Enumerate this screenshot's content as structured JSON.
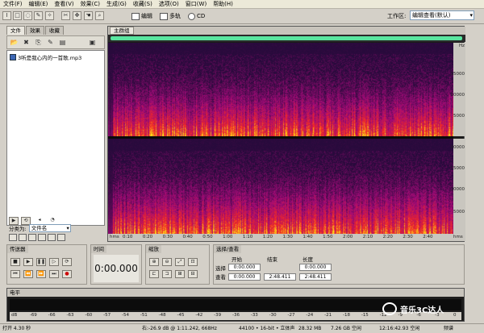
{
  "menu": [
    "文件(F)",
    "编辑(E)",
    "查看(V)",
    "效果(C)",
    "生成(G)",
    "收藏(S)",
    "选项(O)",
    "窗口(W)",
    "帮助(H)"
  ],
  "toolbar": {
    "mode_edit": "编辑",
    "mode_multitrack": "多轨",
    "mode_cd": "CD",
    "workspace_label": "工作区:",
    "workspace_value": "编辑查看(默认)"
  },
  "left_panel": {
    "tabs": [
      "文件",
      "效果",
      "收藏"
    ],
    "file": "3听是我心内的一首歌.mp3",
    "sort_label": "分类为:",
    "sort_value": "文件名"
  },
  "main_panel": {
    "tab": "主群组",
    "freq_unit": "Hz",
    "freq_ticks": [
      "15000",
      "10000",
      "5000",
      "20000",
      "15000",
      "10000",
      "5000"
    ],
    "time_ticks": [
      "hms",
      "0:10",
      "0:20",
      "0:30",
      "0:40",
      "0:50",
      "1:00",
      "1:10",
      "1:20",
      "1:30",
      "1:40",
      "1:50",
      "2:00",
      "2:10",
      "2:20",
      "2:30",
      "2:40",
      "hms"
    ]
  },
  "transport": {
    "title": "传送器"
  },
  "time": {
    "title": "时间",
    "value": "0:00.000"
  },
  "zoom": {
    "title": "缩放"
  },
  "selection": {
    "title": "选择/查看",
    "col_start": "开始",
    "col_end": "结束",
    "col_length": "长度",
    "row_select": "选择",
    "row_view": "查看",
    "sel_start": "0:00.000",
    "sel_length": "0:00.000",
    "view_start": "0:00.000",
    "view_end": "2:48.411",
    "view_length": "2:48.411"
  },
  "level": {
    "title": "电平",
    "scale": [
      "dB",
      "-69",
      "-66",
      "-63",
      "-60",
      "-57",
      "-54",
      "-51",
      "-48",
      "-45",
      "-42",
      "-39",
      "-36",
      "-33",
      "-30",
      "-27",
      "-24",
      "-21",
      "-18",
      "-15",
      "-12",
      "-9",
      "-6",
      "-3",
      "0"
    ]
  },
  "status": {
    "open_time": "打开 4.30 秒",
    "cursor": "右:-26.9 dB @ 1:11.242, 668Hz",
    "format": "44100 • 16-bit • 立体声",
    "size": "28.32 MB",
    "free": "7.26 GB 空闲",
    "free_time": "12:16:42.93 空闲",
    "view": "频谱"
  },
  "watermark": "音乐3C达人",
  "colors": {
    "spec_low": "#2a0a3a",
    "spec_mid": "#c01030",
    "spec_high": "#ffd020",
    "overview": "#59e6a0"
  }
}
